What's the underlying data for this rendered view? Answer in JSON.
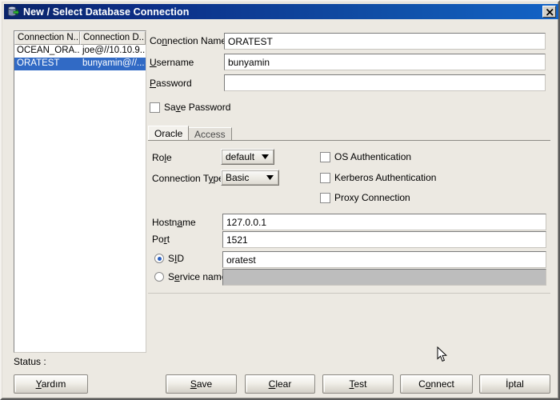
{
  "window": {
    "title": "New / Select Database Connection",
    "icon": "database-icon",
    "close_label": "Close"
  },
  "connection_list": {
    "columns": [
      "Connection N...",
      "Connection D..."
    ],
    "rows": [
      {
        "name": "OCEAN_ORA...",
        "details": "joe@//10.10.9...",
        "selected": false
      },
      {
        "name": "ORATEST",
        "details": "bunyamin@//...",
        "selected": true
      }
    ]
  },
  "form": {
    "connection_name": {
      "label": "Connection Name",
      "value": "ORATEST"
    },
    "username": {
      "label": "Username",
      "value": "bunyamin"
    },
    "password": {
      "label": "Password",
      "value": ""
    },
    "save_password": {
      "label": "Save Password",
      "checked": false
    }
  },
  "tabs": [
    {
      "label": "Oracle",
      "active": true
    },
    {
      "label": "Access",
      "active": false
    }
  ],
  "oracle_panel": {
    "role": {
      "label": "Role",
      "value": "default"
    },
    "connection_type": {
      "label": "Connection Type",
      "value": "Basic"
    },
    "os_authentication": {
      "label": "OS Authentication",
      "checked": false
    },
    "kerberos_authentication": {
      "label": "Kerberos Authentication",
      "checked": false
    },
    "proxy_connection": {
      "label": "Proxy Connection",
      "checked": false
    },
    "hostname": {
      "label": "Hostname",
      "value": "127.0.0.1"
    },
    "port": {
      "label": "Port",
      "value": "1521"
    },
    "sid": {
      "label": "SID",
      "value": "oratest",
      "selected": true
    },
    "service_name": {
      "label": "Service name",
      "value": "",
      "selected": false
    }
  },
  "status": {
    "label": "Status :",
    "value": ""
  },
  "buttons": {
    "help": "Yardım",
    "save": "Save",
    "clear": "Clear",
    "test": "Test",
    "connect": "Connect",
    "cancel": "İptal"
  },
  "colors": {
    "title_start": "#0a246a",
    "title_end": "#1363c6",
    "selection": "#316ac5",
    "dialog_face": "#ece9e2",
    "field_bg": "#ffffff",
    "disabled_bg": "#bdbdbd",
    "radio_dot": "#2a5fc0"
  }
}
